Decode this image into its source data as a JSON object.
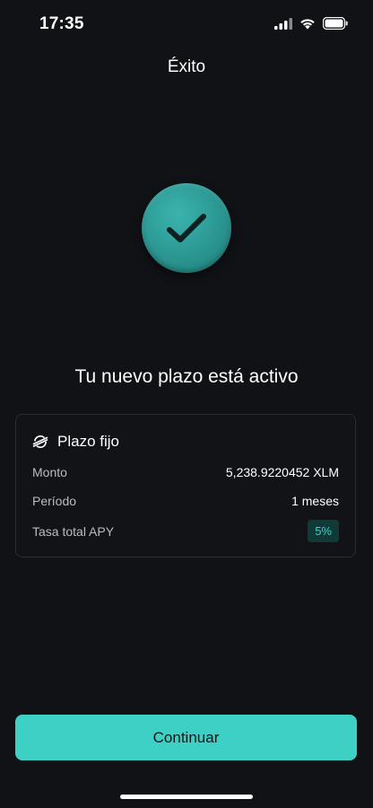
{
  "status_bar": {
    "time": "17:35"
  },
  "header": {
    "title": "Éxito"
  },
  "success": {
    "icon": "check-icon",
    "headline": "Tu nuevo plazo está activo"
  },
  "card": {
    "icon": "stellar-icon",
    "title": "Plazo fijo",
    "rows": [
      {
        "label": "Monto",
        "value": "5,238.9220452 XLM"
      },
      {
        "label": "Período",
        "value": "1 meses"
      },
      {
        "label": "Tasa total APY",
        "value": "5%"
      }
    ]
  },
  "footer": {
    "continue_label": "Continuar"
  },
  "colors": {
    "background": "#111216",
    "accent": "#3ecfc5",
    "badge_bg": "#0f3a38",
    "badge_text": "#40cfc6"
  }
}
